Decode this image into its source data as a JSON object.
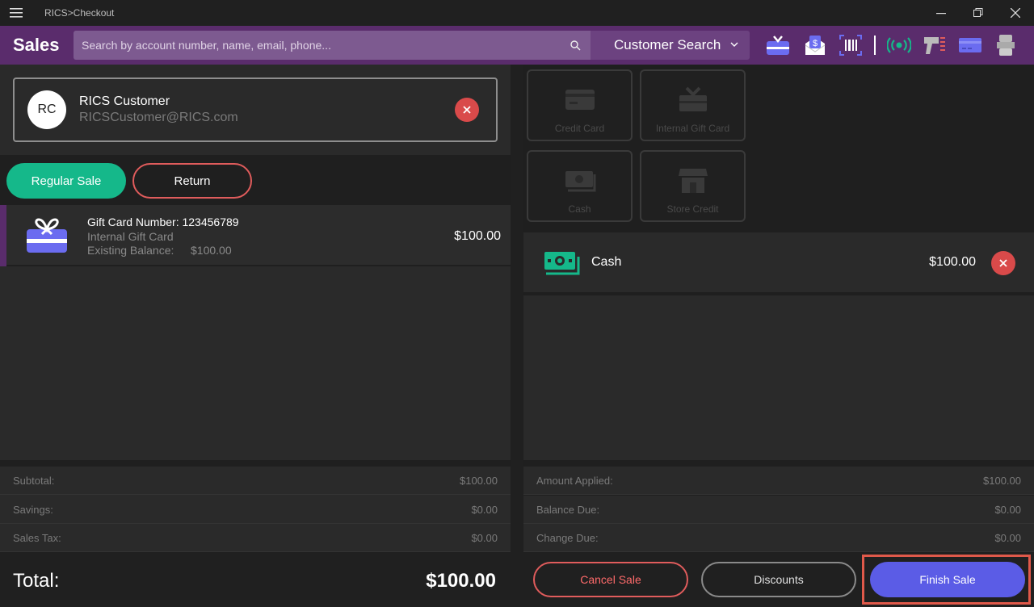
{
  "window": {
    "title": "RICS>Checkout"
  },
  "header": {
    "brand": "Sales",
    "search_placeholder": "Search by account number, name, email, phone...",
    "search_mode": "Customer Search",
    "toolbar_icons": [
      "gift-card-icon",
      "email-receipt-icon",
      "barcode-scan-icon",
      "wireless-icon",
      "scanner-icon",
      "credit-card-icon",
      "printer-icon"
    ]
  },
  "customer": {
    "initials": "RC",
    "name": "RICS Customer",
    "email": "RICSCustomer@RICS.com"
  },
  "mode": {
    "regular": "Regular Sale",
    "return": "Return"
  },
  "line_items": [
    {
      "title": "Gift Card Number: 123456789",
      "subtitle": "Internal Gift Card",
      "balance_label": "Existing Balance:",
      "balance_value": "$100.00",
      "price": "$100.00"
    }
  ],
  "summary": {
    "subtotal_label": "Subtotal:",
    "subtotal": "$100.00",
    "savings_label": "Savings:",
    "savings": "$0.00",
    "tax_label": "Sales Tax:",
    "tax": "$0.00",
    "total_label": "Total:",
    "total": "$100.00"
  },
  "tenders": {
    "credit_card": "Credit Card",
    "internal_gift_card": "Internal Gift Card",
    "cash": "Cash",
    "store_credit": "Store Credit"
  },
  "payments": [
    {
      "label": "Cash",
      "amount": "$100.00"
    }
  ],
  "payment_summary": {
    "applied_label": "Amount Applied:",
    "applied": "$100.00",
    "balance_label": "Balance Due:",
    "balance": "$0.00",
    "change_label": "Change Due:",
    "change": "$0.00"
  },
  "actions": {
    "cancel": "Cancel Sale",
    "discounts": "Discounts",
    "finish": "Finish Sale"
  },
  "colors": {
    "header": "#5a2c6c",
    "accent_green": "#15b88a",
    "danger": "#e05c5c",
    "primary": "#5b5ce6"
  }
}
